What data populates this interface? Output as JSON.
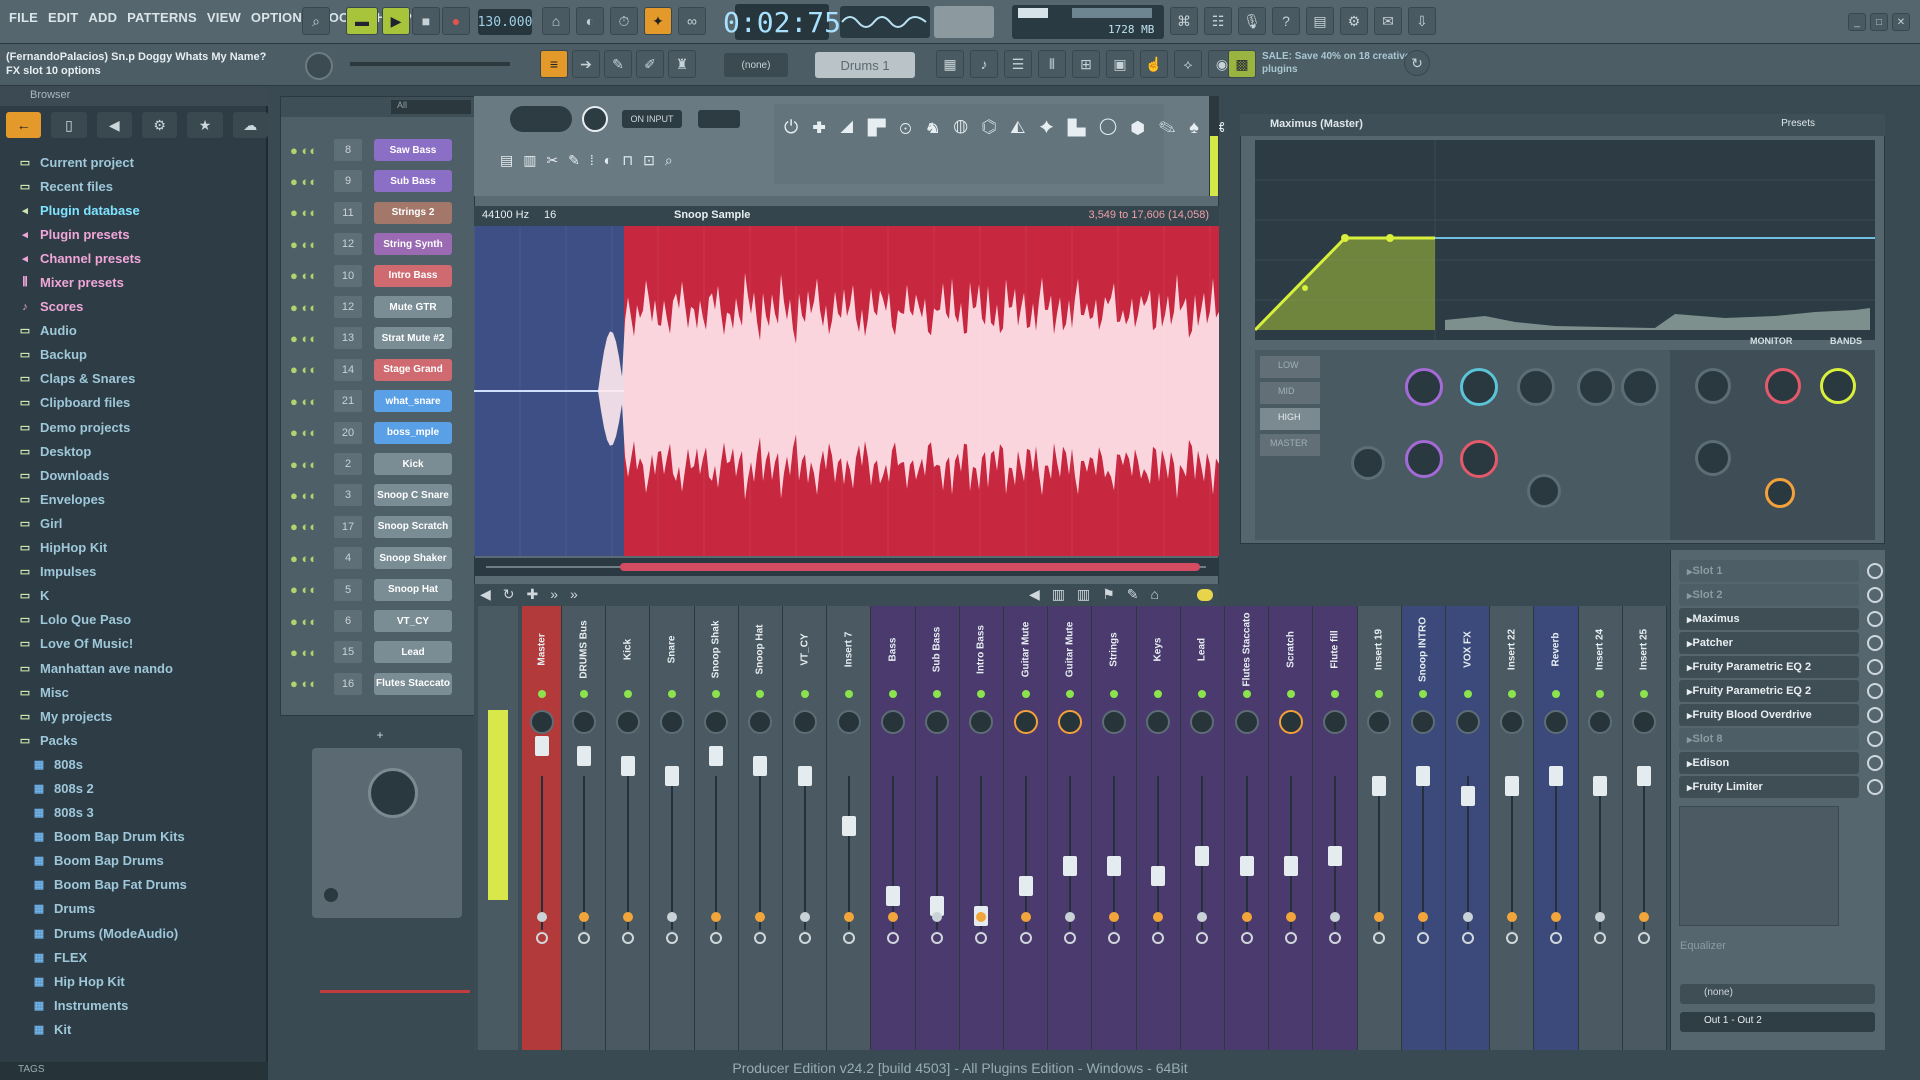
{
  "menu": [
    "FILE",
    "EDIT",
    "ADD",
    "PATTERNS",
    "VIEW",
    "OPTIONS",
    "TOOLS",
    "HELP"
  ],
  "transport": {
    "tempo": "130.000",
    "time": "0:02:75",
    "pattern": "Drums 1",
    "cpu": "1728 MB"
  },
  "song": {
    "title": "(FernandoPalacios) Sn.p Doggy Whats My Name?",
    "subtitle": "FX slot 10 options"
  },
  "news": {
    "text": "SALE: Save 40% on 18 creative plugins"
  },
  "browser": {
    "title": "Browser",
    "items": [
      {
        "label": "Current project",
        "icon": "folder-icon",
        "level": 0,
        "style": "folder"
      },
      {
        "label": "Recent files",
        "icon": "folder-icon",
        "level": 0,
        "style": "folder"
      },
      {
        "label": "Plugin database",
        "icon": "plug-icon",
        "level": 0,
        "style": "hl"
      },
      {
        "label": "Plugin presets",
        "icon": "plug-icon",
        "level": 0,
        "style": "pk"
      },
      {
        "label": "Channel presets",
        "icon": "plug-icon",
        "level": 0,
        "style": "pk"
      },
      {
        "label": "Mixer presets",
        "icon": "mixer-icon",
        "level": 0,
        "style": "pk"
      },
      {
        "label": "Scores",
        "icon": "note-icon",
        "level": 0,
        "style": "pk"
      },
      {
        "label": "Audio",
        "icon": "folder-icon",
        "level": 0,
        "style": "folder"
      },
      {
        "label": "Backup",
        "icon": "folder-icon",
        "level": 0,
        "style": "folder"
      },
      {
        "label": "Claps & Snares",
        "icon": "folder-icon",
        "level": 0,
        "style": "folder"
      },
      {
        "label": "Clipboard files",
        "icon": "folder-icon",
        "level": 0,
        "style": "folder"
      },
      {
        "label": "Demo projects",
        "icon": "folder-icon",
        "level": 0,
        "style": "folder"
      },
      {
        "label": "Desktop",
        "icon": "folder-icon",
        "level": 0,
        "style": "folder"
      },
      {
        "label": "Downloads",
        "icon": "folder-icon",
        "level": 0,
        "style": "folder"
      },
      {
        "label": "Envelopes",
        "icon": "folder-icon",
        "level": 0,
        "style": "folder"
      },
      {
        "label": "Girl",
        "icon": "folder-icon",
        "level": 0,
        "style": "folder"
      },
      {
        "label": "HipHop Kit",
        "icon": "folder-icon",
        "level": 0,
        "style": "folder"
      },
      {
        "label": "Impulses",
        "icon": "folder-icon",
        "level": 0,
        "style": "folder"
      },
      {
        "label": "K",
        "icon": "folder-icon",
        "level": 0,
        "style": "folder"
      },
      {
        "label": "Lolo Que Paso",
        "icon": "folder-icon",
        "level": 0,
        "style": "folder"
      },
      {
        "label": "Love Of Music!",
        "icon": "folder-icon",
        "level": 0,
        "style": "folder"
      },
      {
        "label": "Manhattan ave nando",
        "icon": "folder-icon",
        "level": 0,
        "style": "folder"
      },
      {
        "label": "Misc",
        "icon": "folder-icon",
        "level": 0,
        "style": "folder"
      },
      {
        "label": "My projects",
        "icon": "folder-icon",
        "level": 0,
        "style": "folder"
      },
      {
        "label": "Packs",
        "icon": "folder-icon",
        "level": 0,
        "style": "folder"
      },
      {
        "label": "808s",
        "icon": "pack-icon",
        "level": 1,
        "style": "folder"
      },
      {
        "label": "808s 2",
        "icon": "pack-icon",
        "level": 1,
        "style": "folder"
      },
      {
        "label": "808s 3",
        "icon": "pack-icon",
        "level": 1,
        "style": "folder"
      },
      {
        "label": "Boom Bap Drum Kits",
        "icon": "pack-icon",
        "level": 1,
        "style": "folder"
      },
      {
        "label": "Boom Bap Drums",
        "icon": "pack-icon",
        "level": 1,
        "style": "folder"
      },
      {
        "label": "Boom Bap Fat Drums",
        "icon": "pack-icon",
        "level": 1,
        "style": "folder"
      },
      {
        "label": "Drums",
        "icon": "pack-icon",
        "level": 1,
        "style": "folder"
      },
      {
        "label": "Drums (ModeAudio)",
        "icon": "pack-icon",
        "level": 1,
        "style": "folder"
      },
      {
        "label": "FLEX",
        "icon": "pack-icon",
        "level": 1,
        "style": "folder"
      },
      {
        "label": "Hip Hop Kit",
        "icon": "pack-icon",
        "level": 1,
        "style": "folder"
      },
      {
        "label": "Instruments",
        "icon": "pack-icon",
        "level": 1,
        "style": "folder"
      },
      {
        "label": "Kit",
        "icon": "pack-icon",
        "level": 1,
        "style": "folder"
      }
    ],
    "tags_label": "TAGS"
  },
  "channels": [
    {
      "num": "8",
      "name": "Saw Bass",
      "color": "#8b6ec5"
    },
    {
      "num": "9",
      "name": "Sub Bass",
      "color": "#8b6ec5"
    },
    {
      "num": "11",
      "name": "Strings 2",
      "color": "#a3786a"
    },
    {
      "num": "12",
      "name": "String Synth",
      "color": "#9a6ab3"
    },
    {
      "num": "10",
      "name": "Intro Bass",
      "color": "#cf6b70"
    },
    {
      "num": "12",
      "name": "Mute GTR",
      "color": "#7a8d95"
    },
    {
      "num": "13",
      "name": "Strat Mute #2",
      "color": "#7a8d95"
    },
    {
      "num": "14",
      "name": "Stage Grand",
      "color": "#cf6b70"
    },
    {
      "num": "21",
      "name": "what_snare",
      "color": "#5aa0e6"
    },
    {
      "num": "20",
      "name": "boss_mple",
      "color": "#5aa0e6"
    },
    {
      "num": "2",
      "name": "Kick",
      "color": "#7a8d95"
    },
    {
      "num": "3",
      "name": "Snoop C Snare",
      "color": "#7a8d95"
    },
    {
      "num": "17",
      "name": "Snoop Scratch",
      "color": "#7a8d95"
    },
    {
      "num": "4",
      "name": "Snoop Shaker",
      "color": "#7a8d95"
    },
    {
      "num": "5",
      "name": "Snoop Hat",
      "color": "#7a8d95"
    },
    {
      "num": "6",
      "name": "VT_CY",
      "color": "#7a8d95"
    },
    {
      "num": "15",
      "name": "Lead",
      "color": "#7a8d95"
    },
    {
      "num": "16",
      "name": "Flutes Staccato",
      "color": "#7a8d95"
    }
  ],
  "editor": {
    "sample_name": "Snoop Sample",
    "sample_rate": "44100 Hz",
    "bits": "16",
    "range": "3,549 to 17,606 (14,058)",
    "mode": "ON INPUT"
  },
  "mixer": {
    "strips": [
      {
        "name": "Master",
        "color": "#b33a3a"
      },
      {
        "name": "DRUMS Bus",
        "color": "#4b5a62"
      },
      {
        "name": "Kick",
        "color": "#4b5a62"
      },
      {
        "name": "Snare",
        "color": "#4b5a62"
      },
      {
        "name": "Snoop Shak",
        "color": "#4b5a62"
      },
      {
        "name": "Snoop Hat",
        "color": "#4b5a62"
      },
      {
        "name": "VT_CY",
        "color": "#4b5a62"
      },
      {
        "name": "Insert 7",
        "color": "#4b5a62"
      },
      {
        "name": "Bass",
        "color": "#4a3a6e"
      },
      {
        "name": "Sub Bass",
        "color": "#4a3a6e"
      },
      {
        "name": "Intro Bass",
        "color": "#4a3a6e"
      },
      {
        "name": "Guitar Mute",
        "color": "#4a3a6e"
      },
      {
        "name": "Guitar Mute",
        "color": "#4a3a6e"
      },
      {
        "name": "Strings",
        "color": "#4a3a6e"
      },
      {
        "name": "Keys",
        "color": "#4a3a6e"
      },
      {
        "name": "Lead",
        "color": "#4a3a6e"
      },
      {
        "name": "Flutes Staccato",
        "color": "#4a3a6e"
      },
      {
        "name": "Scratch",
        "color": "#4a3a6e"
      },
      {
        "name": "Flute fill",
        "color": "#4a3a6e"
      },
      {
        "name": "Insert 19",
        "color": "#4b5a62"
      },
      {
        "name": "Snoop INTRO",
        "color": "#3b4a7a"
      },
      {
        "name": "VOX FX",
        "color": "#3b4a7a"
      },
      {
        "name": "Insert 22",
        "color": "#4b5a62"
      },
      {
        "name": "Reverb",
        "color": "#3b4a7a"
      },
      {
        "name": "Insert 24",
        "color": "#4b5a62"
      },
      {
        "name": "Insert 25",
        "color": "#4b5a62"
      }
    ]
  },
  "maximus": {
    "title": "Maximus (Master)",
    "presets_label": "Presets",
    "monitor_label": "MONITOR",
    "bands_label": "BANDS",
    "left_labels": [
      "LOW",
      "MID",
      "HIGH",
      "MASTER"
    ]
  },
  "inserts": [
    {
      "label": "Slot 1",
      "on": false
    },
    {
      "label": "Slot 2",
      "on": false
    },
    {
      "label": "Maximus",
      "on": true
    },
    {
      "label": "Patcher",
      "on": true
    },
    {
      "label": "Fruity Parametric EQ 2",
      "on": true
    },
    {
      "label": "Fruity Parametric EQ 2",
      "on": true
    },
    {
      "label": "Fruity Blood Overdrive",
      "on": true
    },
    {
      "label": "Slot 8",
      "on": false
    },
    {
      "label": "Edison",
      "on": true
    },
    {
      "label": "Fruity Limiter",
      "on": true
    }
  ],
  "insert_footer": {
    "eq_label": "Equalizer",
    "none_label": "(none)",
    "out_label": "Out 1 - Out 2"
  },
  "status": "Producer Edition v24.2 [build 4503] - All Plugins Edition - Windows - 64Bit"
}
